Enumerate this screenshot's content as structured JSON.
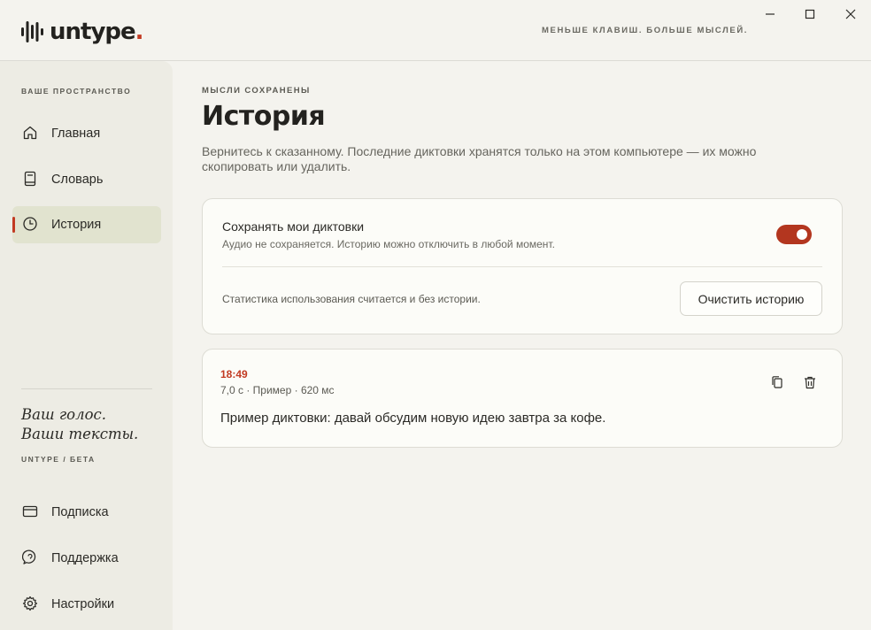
{
  "app": {
    "logo_text": "untype",
    "logo_dot": ".",
    "tagline": "МЕНЬШЕ КЛАВИШ. БОЛЬШЕ МЫСЛЕЙ."
  },
  "window_controls": {
    "minimize_icon": "minimize-icon",
    "maximize_icon": "maximize-icon",
    "close_icon": "close-icon"
  },
  "sidebar": {
    "section_label": "ВАШЕ ПРОСТРАНСТВО",
    "nav_items": [
      {
        "label": "Главная",
        "icon": "home-icon",
        "active": false
      },
      {
        "label": "Словарь",
        "icon": "book-icon",
        "active": false
      },
      {
        "label": "История",
        "icon": "clock-icon",
        "active": true
      }
    ],
    "quote_line1": "Ваш голос.",
    "quote_line2": "Ваши тексты.",
    "beta_label": "UNTYPE / БЕТА",
    "bottom_items": [
      {
        "label": "Подписка",
        "icon": "card-icon"
      },
      {
        "label": "Поддержка",
        "icon": "chat-icon"
      },
      {
        "label": "Настройки",
        "icon": "gear-icon"
      }
    ]
  },
  "main": {
    "eyebrow": "МЫСЛИ СОХРАНЕНЫ",
    "title": "История",
    "description": "Вернитесь к сказанному. Последние диктовки хранятся только на этом компьютере — их можно скопировать или удалить.",
    "settings_card": {
      "save_title": "Сохранять мои диктовки",
      "save_subtitle": "Аудио не сохраняется. Историю можно отключить в любой момент.",
      "save_enabled": true,
      "stats_text": "Статистика использования считается и без истории.",
      "clear_button": "Очистить историю"
    },
    "entries": [
      {
        "time": "18:49",
        "meta": "7,0 с · Пример · 620 мс",
        "text": "Пример диктовки: давай обсудим новую идею завтра за кофе.",
        "copy_icon": "copy-icon",
        "delete_icon": "trash-icon"
      }
    ]
  },
  "colors": {
    "accent": "#c23a22",
    "toggle_on": "#b3361f",
    "background": "#f4f3ee",
    "sidebar": "#edece4",
    "active_nav": "#e1e3cf"
  }
}
